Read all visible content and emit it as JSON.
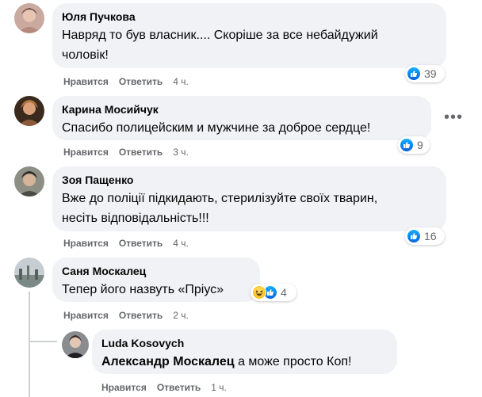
{
  "comments": [
    {
      "author": "Юля Пучкова",
      "text": "Навряд то був власник.... Скоріше за все небайдужий чоловік!",
      "line1": "Навряд то був власник.... Скоріше за все небайдужий",
      "line2": "чоловік!",
      "like_label": "Нравится",
      "reply_label": "Ответить",
      "time": "4 ч.",
      "reaction_count": "39"
    },
    {
      "author": "Карина Мосийчук",
      "line1": "Спасибо полицейским и мужчине за доброе сердце!",
      "like_label": "Нравится",
      "reply_label": "Ответить",
      "time": "3 ч.",
      "reaction_count": "9",
      "more_label": "•••"
    },
    {
      "author": "Зоя Пащенко",
      "line1": "Вже до поліції підкидають, стерилізуйте своїх тварин,",
      "line2": "несіть відповідальність!!!",
      "like_label": "Нравится",
      "reply_label": "Ответить",
      "time": "4 ч.",
      "reaction_count": "16"
    },
    {
      "author": "Саня Москалец",
      "line1": "Тепер його назвуть «Пріус»",
      "like_label": "Нравится",
      "reply_label": "Ответить",
      "time": "2 ч.",
      "reaction_count": "4"
    }
  ],
  "reply": {
    "author": "Luda Kosovych",
    "mention": "Александр Москалец",
    "text": " а може просто Коп!",
    "like_label": "Нравится",
    "reply_label": "Ответить",
    "time": "1 ч."
  },
  "colors": {
    "bubble": "#f0f2f5",
    "meta": "#65676b",
    "like_blue": "#0866ff"
  },
  "icons": [
    "like-icon",
    "haha-icon",
    "more-options-icon"
  ]
}
